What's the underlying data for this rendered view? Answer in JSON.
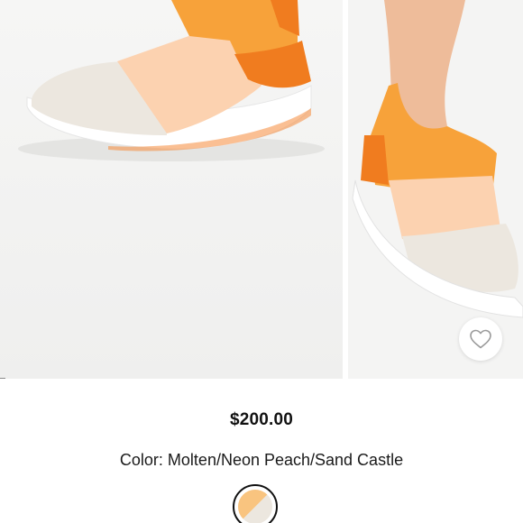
{
  "product": {
    "price": "$200.00",
    "color_label": "Color:",
    "color_value": "Molten/Neon Peach/Sand Castle"
  },
  "gallery": {
    "images": [
      {
        "alt": "sneaker-side-view"
      },
      {
        "alt": "sneaker-on-foot"
      }
    ]
  },
  "icons": {
    "wishlist": "heart-outline-icon"
  },
  "colors": {
    "orange": "#f7a23a",
    "deep_orange": "#f07c1f",
    "peach": "#fcd2b0",
    "sand": "#ece7df",
    "sole": "#ffffff"
  }
}
